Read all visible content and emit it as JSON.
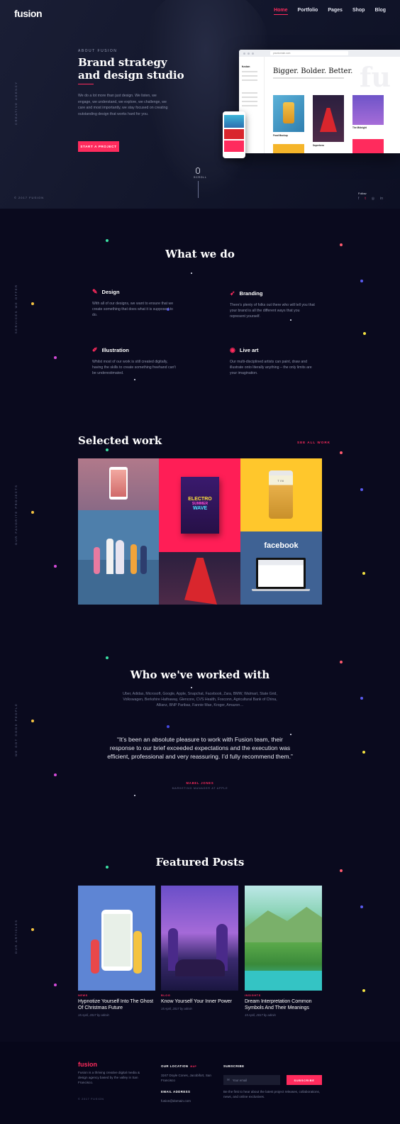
{
  "header": {
    "logo": "fusion",
    "nav": [
      "Home",
      "Portfolio",
      "Pages",
      "Shop",
      "Blog"
    ],
    "active": "Home"
  },
  "hero": {
    "kicker": "ABOUT FUSION",
    "title": "Brand strategy and design studio",
    "text": "We do a lot more than just design. We listen, we engage, we understand, we explore, we challenge, we care and most importantly, we stay focused on creating outstanding design that works hard for you.",
    "cta": "START A PROJECT",
    "side_label": "CREATIVE AGENCY",
    "copyright": "© 2017 FUSION",
    "scroll": "SCROLL",
    "follow": "Follow",
    "socials": [
      "f",
      "t",
      "◎",
      "in"
    ],
    "mockup": {
      "url": "yourdomain.com",
      "side_logo": "fusion",
      "headline": "Bigger. Bolder. Better.",
      "watermark": "fu",
      "captions": [
        "Food Mockup",
        "Superhero",
        "The Midnight"
      ]
    }
  },
  "services": {
    "title": "What we do",
    "side_label": "SERVICES WE OFFER",
    "items": [
      {
        "icon": "✎",
        "name": "Design",
        "text": "With all of our designs, we want to ensure that we create something that does what it is supposed to do."
      },
      {
        "icon": "➶",
        "name": "Branding",
        "text": "There's plenty of folks out there who will tell you that your brand is all the different ways that you represent yourself."
      },
      {
        "icon": "✐",
        "name": "Illustration",
        "text": "Whilst most of our work is still created digitally, having the skills to create something freehand can't be underestimated."
      },
      {
        "icon": "◉",
        "name": "Live art",
        "text": "Our multi-disciplined artists can paint, draw and illustrate onto literally anything – the only limits are your imagination."
      }
    ]
  },
  "work": {
    "title": "Selected work",
    "see_all": "SEE ALL WORK",
    "side_label": "OUR FAVORITE PROJECTS",
    "poster": {
      "line1": "ELECTRO",
      "line2": "SUMMER",
      "line3": "WAVE"
    },
    "facebook": "facebook",
    "jar_label": "TIN"
  },
  "clients": {
    "title": "Who we've worked with",
    "side_label": "WE GOT GOOD PEOPLE",
    "list": "Uber, Adidas, Microsoft, Google, Apple, Snapchat, Facebook, Zara, BMW, Walmart, State Grid, Volkswagen, Berkshire Hathaway, Glencore, CVS Health, Foxconn, Agricultural Bank of China, Allianz, BNP Paribas, Fannie Mae, Kroger, Amazon…",
    "quote": "“It’s been an absolute pleasure to work with Fusion team, their response to our brief exceeded expectations and the execution was efficient, professional and very reassuring. I’d fully recommend them.”",
    "name": "MABEL JONES",
    "role": "MARKETING MANAGER AT APPLE"
  },
  "posts": {
    "title": "Featured Posts",
    "side_label": "OUR ARTICLES",
    "items": [
      {
        "cat": "NEWS",
        "title": "Hypnotize Yourself Into The Ghost Of Christmas Future",
        "date": "15 April, 2017 by admin"
      },
      {
        "cat": "BLOG",
        "title": "Know Yourself Your Inner Power",
        "date": "15 April, 2017 by admin"
      },
      {
        "cat": "INSIGHTS",
        "title": "Dream Interpretation Common Symbols And Their Meanings",
        "date": "15 April, 2017 by admin"
      }
    ]
  },
  "footer": {
    "logo": "fusion",
    "desc": "Fusion is a thriving creative digital media & design agency based by the valley in San Francisco.",
    "copyright": "© 2017 FUSION",
    "location_label": "OUR LOCATION",
    "location_tag": "MAP",
    "address": "3247 Doyle Cones, Jacobifort, San Francisco",
    "email_label": "EMAIL ADDRESS",
    "email": "fusion@domain.com",
    "subscribe_label": "SUBSCRIBE",
    "email_placeholder": "Your email",
    "subscribe_btn": "SUBSCRIBE",
    "subscribe_text": "Be the first to hear about the latest project releases, collaborations, news, and online exclusives."
  },
  "colors": {
    "accent": "#ff2b5d",
    "background": "#0a0a1e"
  }
}
